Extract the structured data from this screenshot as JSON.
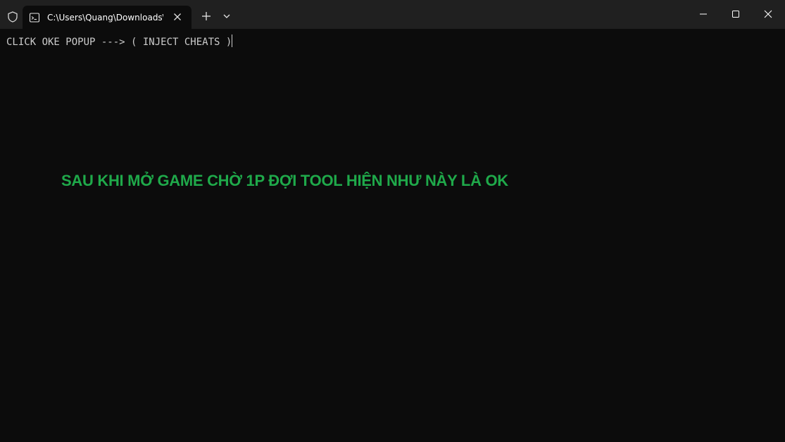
{
  "window": {
    "tab_title": "C:\\Users\\Quang\\Downloads\\T",
    "icons": {
      "shield": "shield-icon",
      "tab": "terminal-icon",
      "tab_close": "close-icon",
      "new_tab": "plus-icon",
      "dropdown": "chevron-down-icon",
      "minimize": "minimize-icon",
      "maximize": "maximize-icon",
      "close": "close-icon"
    }
  },
  "terminal": {
    "line": "CLICK OKE POPUP ---> ( INJECT CHEATS )"
  },
  "overlay": {
    "text": "SAU KHI MỞ GAME CHỜ 1P ĐỢI TOOL HIỆN NHƯ NÀY LÀ OK"
  },
  "colors": {
    "terminal_background": "#0c0c0c",
    "titlebar_background": "#202020",
    "terminal_text": "#cccccc",
    "overlay_text": "#1fa94a"
  }
}
